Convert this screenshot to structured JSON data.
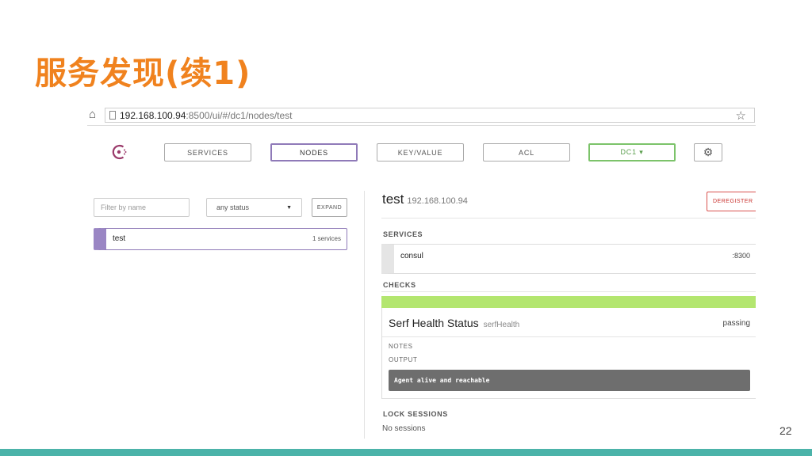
{
  "slide": {
    "title": "服务发现(续1)",
    "page_number": "22"
  },
  "browser": {
    "url_host": "192.168.100.94",
    "url_rest": ":8500/ui/#/dc1/nodes/test"
  },
  "nav": {
    "items": [
      {
        "label": "SERVICES",
        "active": false
      },
      {
        "label": "NODES",
        "active": true
      },
      {
        "label": "KEY/VALUE",
        "active": false
      },
      {
        "label": "ACL",
        "active": false
      }
    ],
    "datacenter": "DC1 ▾"
  },
  "filters": {
    "name_placeholder": "Filter by name",
    "status_value": "any status",
    "expand_label": "EXPAND"
  },
  "nodes": [
    {
      "name": "test",
      "services": "1 services"
    }
  ],
  "detail": {
    "node_name": "test",
    "node_ip": "192.168.100.94",
    "deregister_label": "DEREGISTER",
    "services_heading": "SERVICES",
    "services": [
      {
        "name": "consul",
        "port": ":8300"
      }
    ],
    "checks_heading": "CHECKS",
    "checks": [
      {
        "name": "Serf Health Status",
        "check_id": "serfHealth",
        "status": "passing",
        "notes_label": "NOTES",
        "output_label": "OUTPUT",
        "output": "Agent alive and reachable"
      }
    ],
    "lock_heading": "LOCK SESSIONS",
    "lock_value": "No sessions"
  },
  "colors": {
    "title": "#f0821e",
    "active_nav": "#8f7ab8",
    "datacenter": "#7cc36a",
    "passing": "#b3e66f",
    "deregister": "#d9534f",
    "footer": "#4bb3a9"
  }
}
